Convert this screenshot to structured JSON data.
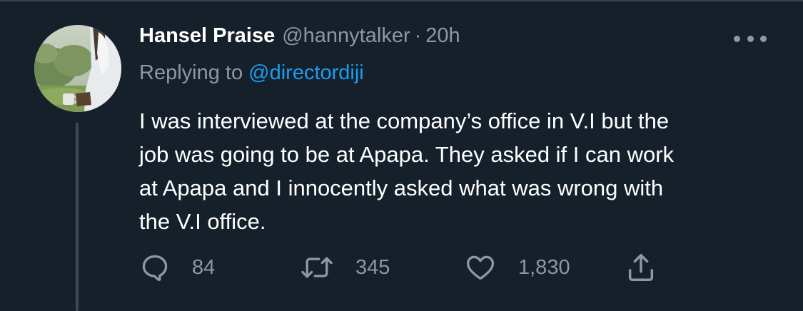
{
  "tweet": {
    "author_name": "Hansel Praise",
    "handle": "@hannytalker",
    "separator": "·",
    "time": "20h",
    "replying_prefix": "Replying to ",
    "replying_to": "@directordiji",
    "body_lines": [
      "I was interviewed at the company’s office in V.I but the",
      "job was going to be at Apapa. They asked if I can work",
      "at Apapa and I innocently asked what was wrong with",
      "the V.I office."
    ]
  },
  "actions": {
    "replies": {
      "icon": "reply-icon",
      "count": "84"
    },
    "retweets": {
      "icon": "retweet-icon",
      "count": "345"
    },
    "likes": {
      "icon": "heart-icon",
      "count": "1,830"
    },
    "share": {
      "icon": "share-icon"
    }
  },
  "colors": {
    "background": "#15202b",
    "primary_text": "#ffffff",
    "secondary_text": "#8b98a5",
    "link": "#1d9bf0",
    "thread_line": "#3d4a55"
  }
}
